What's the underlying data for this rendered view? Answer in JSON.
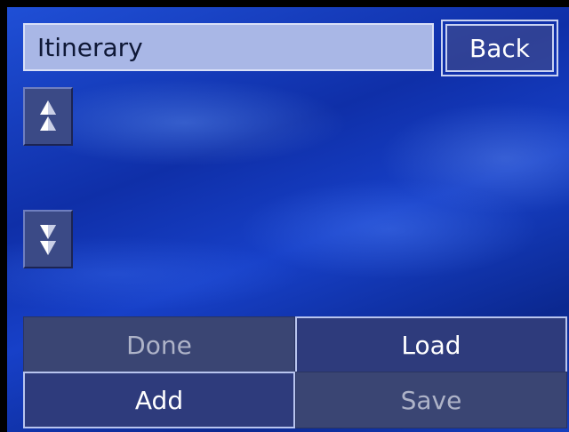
{
  "header": {
    "title": "Itinerary",
    "back_label": "Back"
  },
  "scroll": {
    "up_icon": "double-up-arrow-icon",
    "down_icon": "double-down-arrow-icon"
  },
  "actions": {
    "done_label": "Done",
    "load_label": "Load",
    "add_label": "Add",
    "save_label": "Save",
    "done_enabled": false,
    "load_enabled": true,
    "add_enabled": true,
    "save_enabled": false
  },
  "colors": {
    "background": "#1740c8",
    "title_field": "#a9b7e6",
    "button_enabled": "#2e3b7c",
    "button_disabled": "#3a4573",
    "disabled_text": "#aeb3c8"
  }
}
